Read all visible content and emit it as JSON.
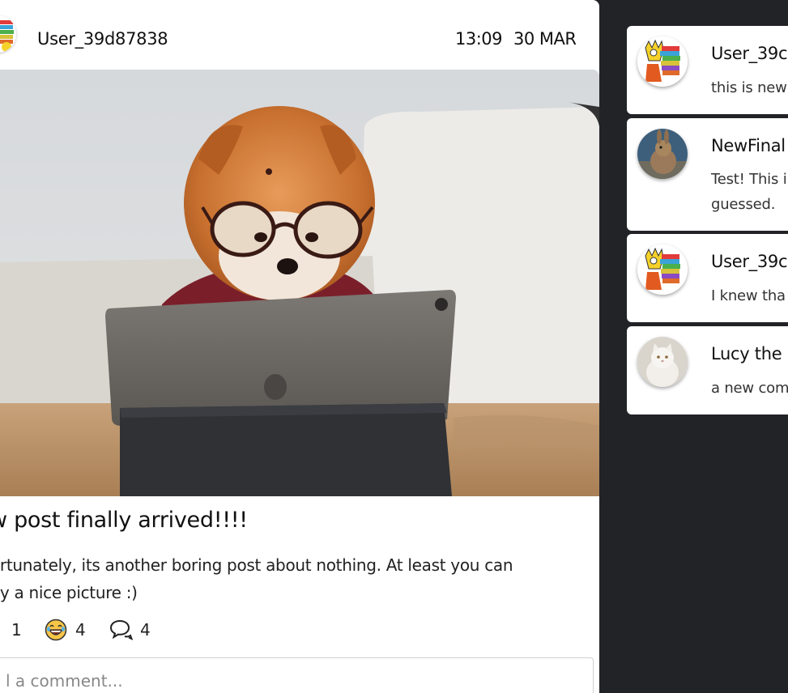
{
  "post": {
    "author": "User_39d87838",
    "time": "13:09",
    "date": "30 MAR",
    "image_alt": "Pomeranian dog wearing glasses looking at a tablet",
    "title": "w post finally arrived!!!!",
    "body": "ortunately, its another boring post about nothing. At least you can\noy a nice picture :)",
    "reactions": [
      {
        "icon": "heart-icon",
        "count": "1"
      },
      {
        "icon": "laughing-face-icon",
        "count": "4"
      },
      {
        "icon": "comment-bubbles-icon",
        "count": "4"
      }
    ],
    "comment_placeholder": "l a comment..."
  },
  "sidebar": {
    "comments": [
      {
        "author": "User_39c",
        "text": "this is new",
        "avatar": "lisa-avatar"
      },
      {
        "author": "NewFinal",
        "text": "Test! This i\nguessed.",
        "avatar": "rabbit-avatar"
      },
      {
        "author": "User_39c",
        "text": "I knew tha",
        "avatar": "lisa-avatar"
      },
      {
        "author": "Lucy the ",
        "text": "a new com",
        "avatar": "white-cat-avatar"
      }
    ]
  },
  "colors": {
    "background_dark": "#212327",
    "card": "#ffffff",
    "text": "#111111"
  }
}
